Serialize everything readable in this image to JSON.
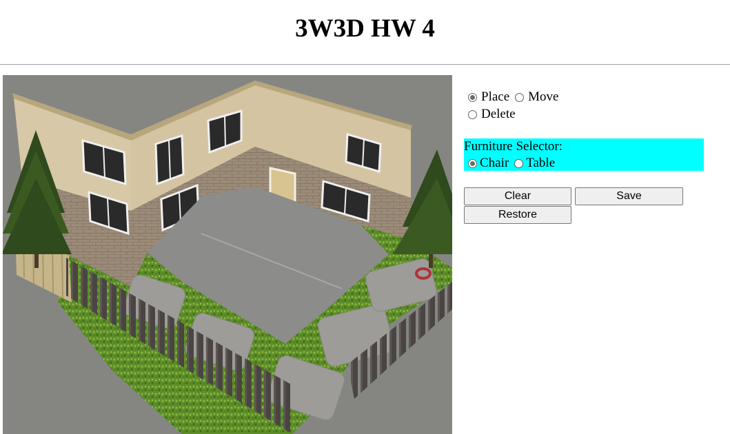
{
  "page": {
    "title": "3W3D HW 4"
  },
  "mode_controls": {
    "options": [
      {
        "label": "Place",
        "checked": true
      },
      {
        "label": "Move",
        "checked": false
      },
      {
        "label": "Delete",
        "checked": false
      }
    ]
  },
  "furniture_selector": {
    "title": "Furniture Selector:",
    "background": "#00ffff",
    "options": [
      {
        "label": "Chair",
        "checked": true
      },
      {
        "label": "Table",
        "checked": false
      }
    ]
  },
  "buttons": {
    "clear": "Clear",
    "save": "Save",
    "restore": "Restore"
  },
  "scene": {
    "background": "#858682",
    "marker_color": "#b0313a"
  }
}
